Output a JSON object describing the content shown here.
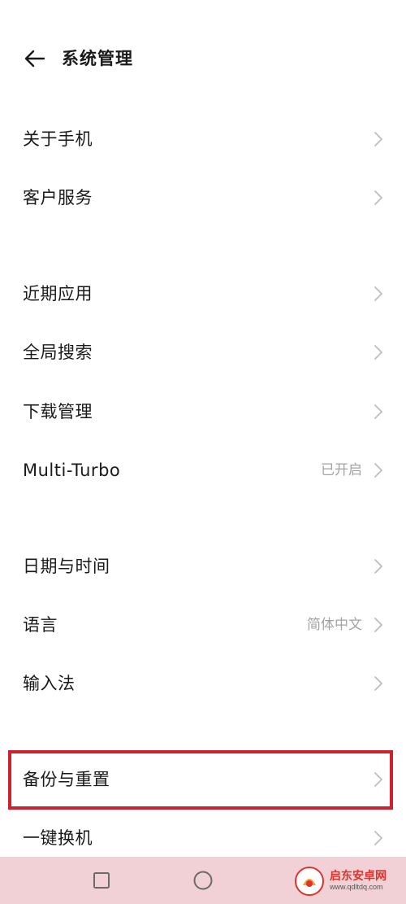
{
  "header": {
    "title": "系统管理"
  },
  "menu": [
    {
      "label": "关于手机",
      "value": ""
    },
    {
      "label": "客户服务",
      "value": ""
    },
    {
      "label": "近期应用",
      "value": ""
    },
    {
      "label": "全局搜索",
      "value": ""
    },
    {
      "label": "下载管理",
      "value": ""
    },
    {
      "label": "Multi-Turbo",
      "value": "已开启"
    },
    {
      "label": "日期与时间",
      "value": ""
    },
    {
      "label": "语言",
      "value": "简体中文"
    },
    {
      "label": "输入法",
      "value": ""
    },
    {
      "label": "备份与重置",
      "value": ""
    },
    {
      "label": "一键换机",
      "value": ""
    }
  ],
  "watermark": {
    "name": "启东安卓网",
    "url": "www.qdltdq.com"
  },
  "colors": {
    "highlight": "#d0202e",
    "nav_bar": "#f1d1d5",
    "secondary_text": "#a3a3a3",
    "chevron": "#bdbdbd"
  },
  "icons": {
    "back": "arrow-left-icon",
    "chevron": "chevron-right-icon",
    "recent": "square-icon",
    "home": "circle-icon"
  }
}
